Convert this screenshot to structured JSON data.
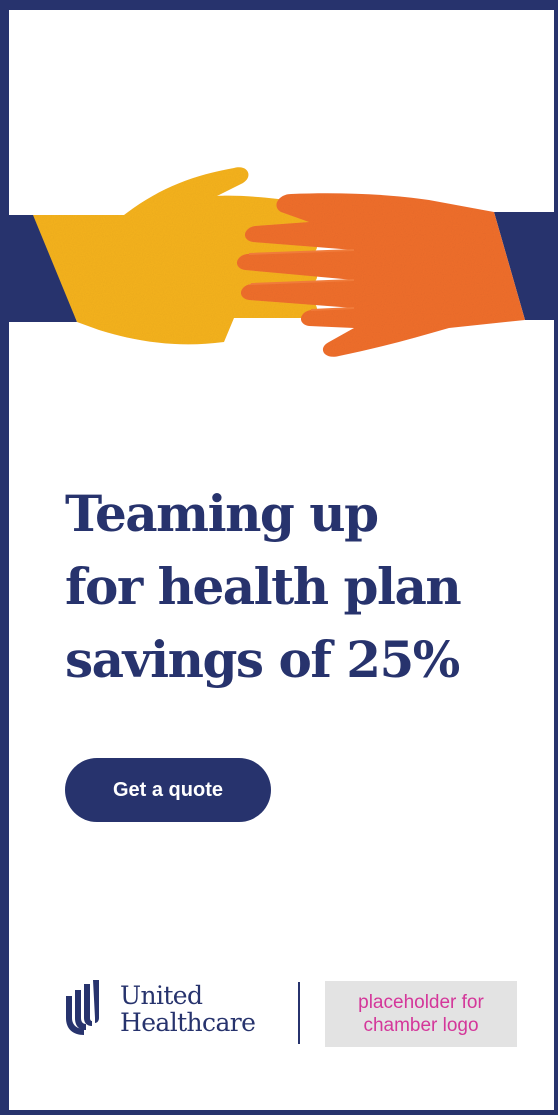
{
  "ad": {
    "headline_lines": [
      "Teaming up",
      "for health plan",
      "savings of 25%"
    ],
    "cta_label": "Get a quote",
    "brand_lines": [
      "United",
      "Healthcare"
    ],
    "chamber_placeholder_lines": [
      "placeholder for",
      "chamber logo"
    ]
  },
  "colors": {
    "navy": "#27336d",
    "hand_left": "#f5b21c",
    "hand_right": "#ef6e2c",
    "placeholder_text": "#d4379a",
    "placeholder_bg": "#e3e3e3"
  },
  "icons": [
    "handshake-illustration",
    "united-healthcare-logo-icon"
  ]
}
